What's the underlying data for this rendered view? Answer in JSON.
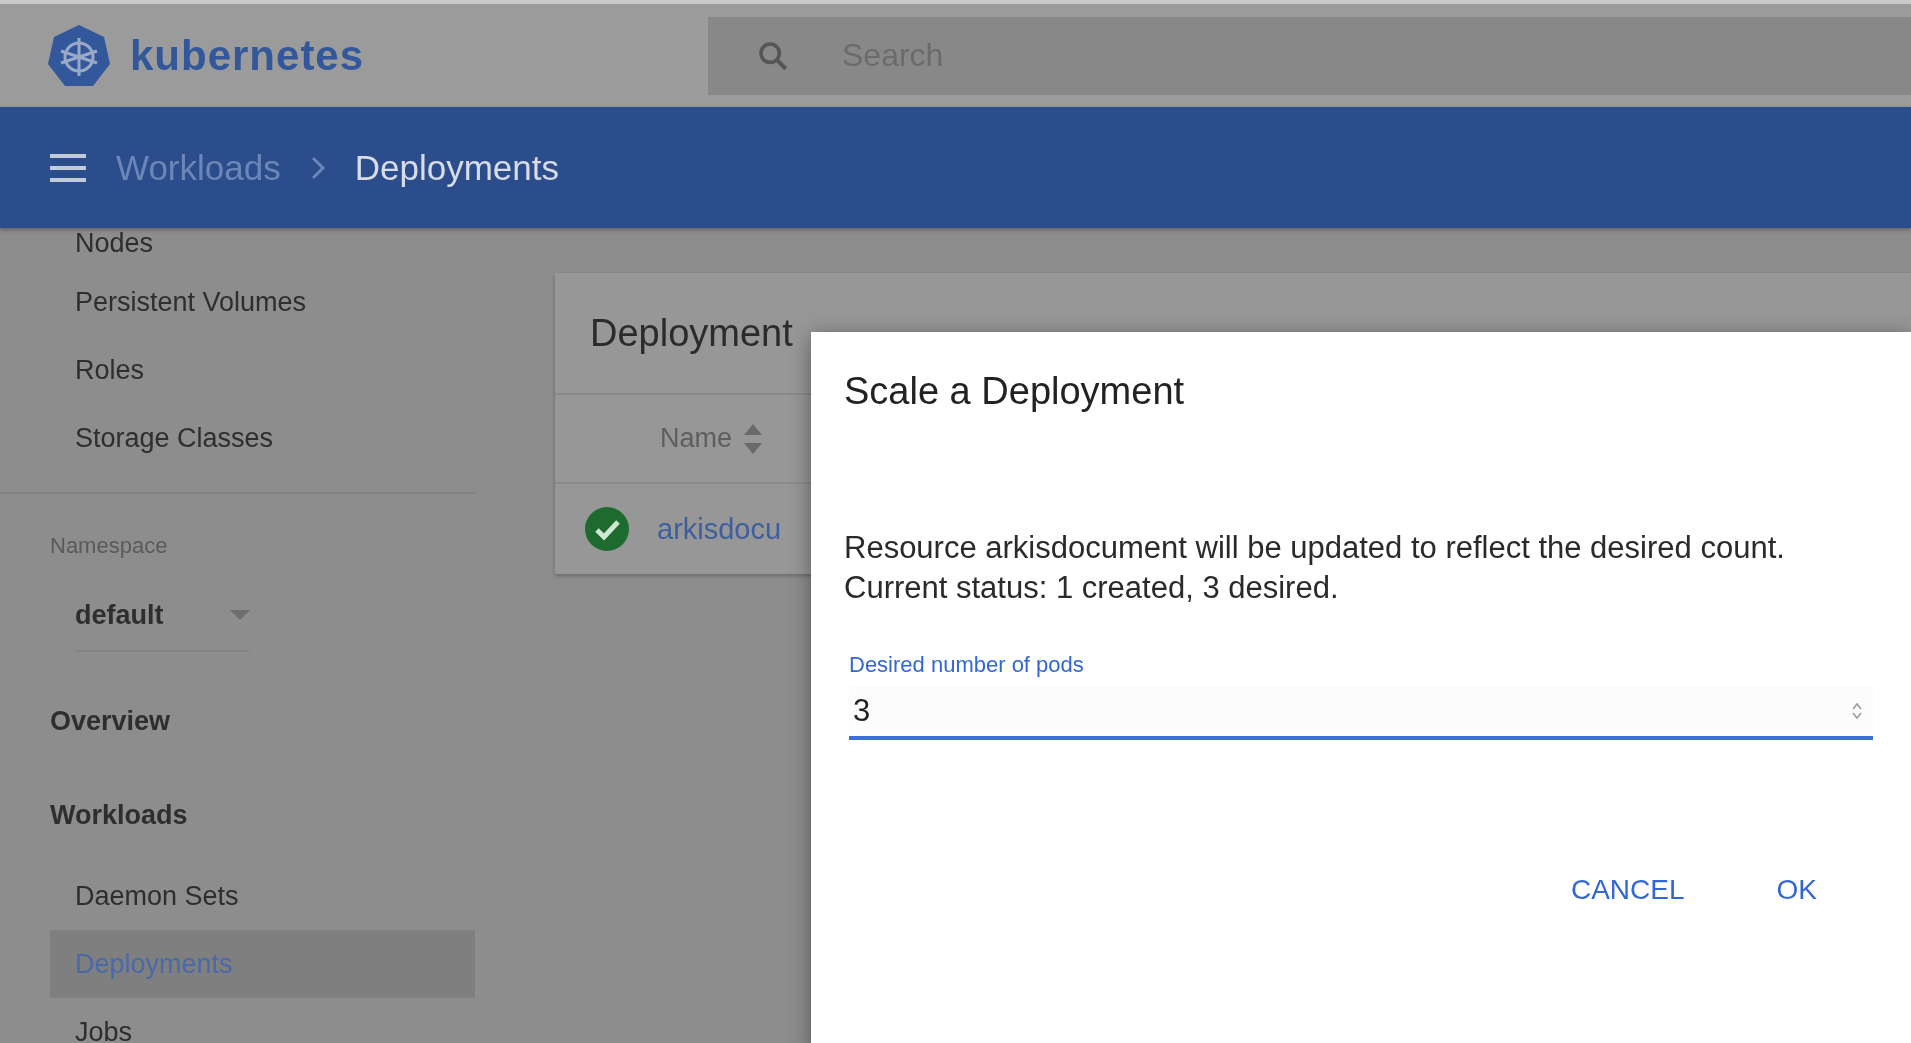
{
  "header": {
    "logo": "kubernetes",
    "search": {
      "placeholder": "Search"
    }
  },
  "breadcrumb": [
    {
      "label": "Workloads",
      "current": false
    },
    {
      "label": "Deployments",
      "current": true
    }
  ],
  "sidebar": {
    "top_items": [
      {
        "label": "Nodes",
        "selected": false
      },
      {
        "label": "Persistent Volumes",
        "selected": false
      },
      {
        "label": "Roles",
        "selected": false
      },
      {
        "label": "Storage Classes",
        "selected": false
      }
    ],
    "namespace": {
      "label": "Namespace",
      "value": "default"
    },
    "sections": [
      {
        "title": "Overview"
      },
      {
        "title": "Workloads",
        "items": [
          {
            "label": "Daemon Sets",
            "selected": false
          },
          {
            "label": "Deployments",
            "selected": true
          },
          {
            "label": "Jobs",
            "selected": false
          }
        ]
      }
    ]
  },
  "card": {
    "title": "Deployment",
    "columns": [
      {
        "label": "Name"
      }
    ],
    "rows": [
      {
        "healthy": true,
        "name": "arkisdocu"
      }
    ]
  },
  "dialog": {
    "title": "Scale a Deployment",
    "message": [
      "Resource arkisdocument will be updated to reflect the desired count.",
      "Current status: 1 created, 3 desired."
    ],
    "field": {
      "label": "Desired number of pods",
      "value": "3",
      "focused": true
    },
    "buttons": [
      {
        "label": "CANCEL"
      },
      {
        "label": "OK"
      }
    ]
  }
}
